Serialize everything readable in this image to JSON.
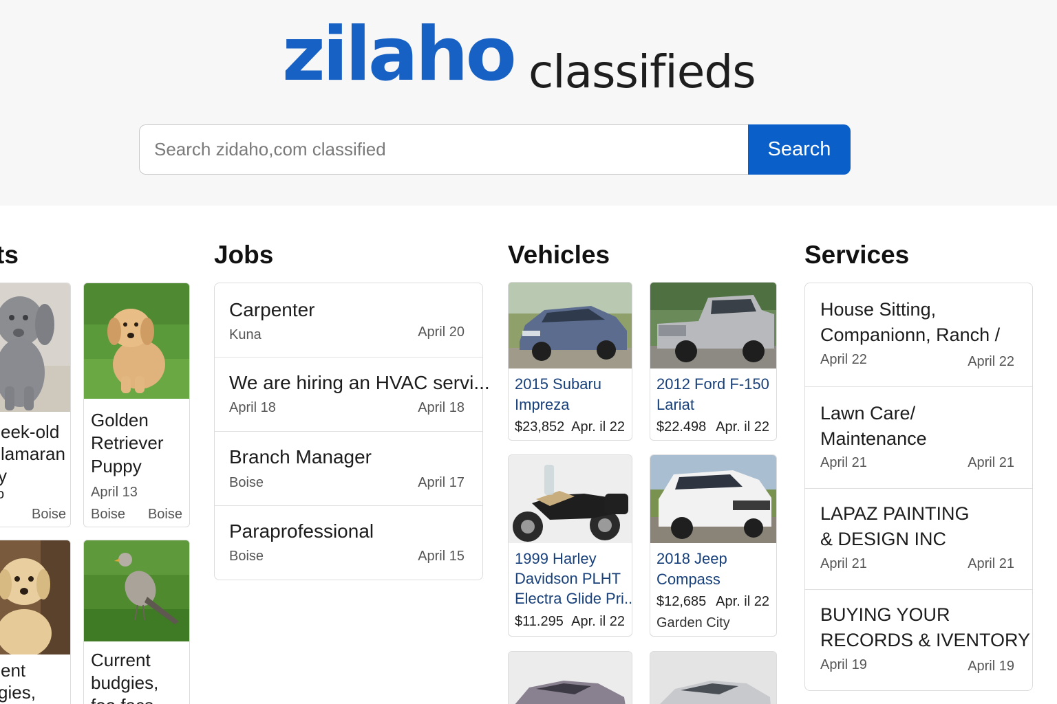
{
  "logo": {
    "brand": "zilaho",
    "suffix": "classifieds"
  },
  "search": {
    "placeholder": "Search zidaho,com classified",
    "button_label": "Search"
  },
  "sections": {
    "pets": "ts",
    "jobs": "Jobs",
    "vehicles": "Vehicles",
    "services": "Services"
  },
  "pets": [
    {
      "title_lines": [
        "eek-old",
        "lamaran",
        "y",
        "o"
      ],
      "location": "Boise",
      "image": "weimaraner-puppy-photo"
    },
    {
      "title_lines": [
        "Golden",
        "Retriever",
        "Puppy"
      ],
      "date": "April 13",
      "location_left": "Boise",
      "location_right": "Boise",
      "image": "golden-retriever-puppy-photo"
    },
    {
      "title_lines": [
        "ent",
        "gies,"
      ],
      "image": "labrador-puppy-photo"
    },
    {
      "title_lines": [
        "Current",
        "budgies,",
        "foo facs"
      ],
      "image": "bird-on-grass-photo"
    }
  ],
  "jobs": [
    {
      "title": "Carpenter",
      "location": "Kuna",
      "date": "April 20"
    },
    {
      "title": "We are hiring an HVAC servi...",
      "location": "April 18",
      "date": "April 18"
    },
    {
      "title": "Branch Manager",
      "location": "Boise",
      "date": "April 17"
    },
    {
      "title": "Paraprofessional",
      "location": "Boise",
      "date": "April 15"
    }
  ],
  "vehicles": [
    {
      "title_lines": [
        "2015 Subaru",
        "Impreza"
      ],
      "price": "$23,852",
      "date": "Apr. il 22",
      "image": "blue-hatchback-photo"
    },
    {
      "title_lines": [
        "2012 Ford F-150",
        "Lariat"
      ],
      "price": "$22.498",
      "date": "Apr. il 22",
      "image": "silver-pickup-truck-photo"
    },
    {
      "title_lines": [
        "1999 Harley",
        "Davidson PLHT",
        "Electra Glide Pri..."
      ],
      "price": "$11.295",
      "date": "Apr. il 22",
      "image": "motorcycle-photo"
    },
    {
      "title_lines": [
        "2018 Jeep",
        "Compass"
      ],
      "price": "$12,685",
      "date": "Apr. il 22",
      "location": "Garden City",
      "image": "white-suv-photo"
    },
    {
      "image": "gray-sedan-photo"
    },
    {
      "image": "silver-sedan-photo"
    }
  ],
  "services": [
    {
      "title_lines": [
        "House Sitting,",
        "Companionn, Ranch /"
      ],
      "date_left": "April 22",
      "date_right": "April 22"
    },
    {
      "title_lines": [
        "Lawn Care/",
        "Maintenance"
      ],
      "date_left": "April 21",
      "date_right": "April 21"
    },
    {
      "title_lines": [
        "LAPAZ PAINTING",
        "& DESIGN INC"
      ],
      "date_left": "April 21",
      "date_right": "April 21"
    },
    {
      "title_lines": [
        "BUYING YOUR",
        "RECORDS & IVENTORY"
      ],
      "date_left": "April 19",
      "date_right": "April 19"
    }
  ],
  "colors": {
    "brand_blue": "#1760c4",
    "button_blue": "#0b5fc9",
    "vehicle_title": "#18407a"
  }
}
